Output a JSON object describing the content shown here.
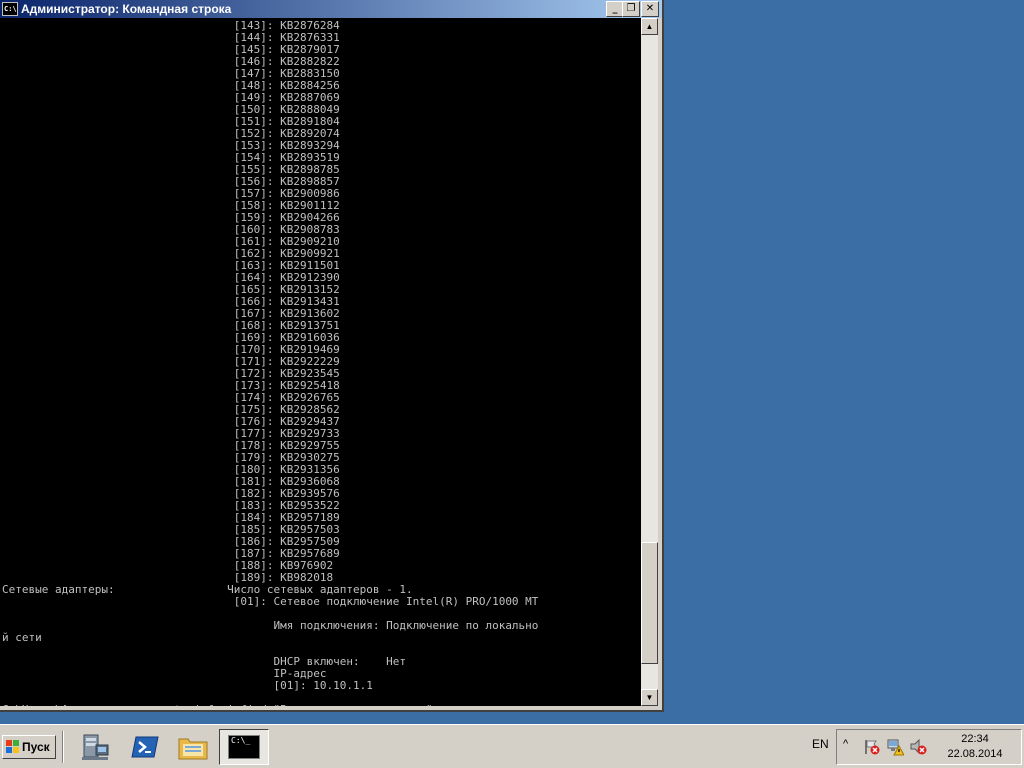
{
  "window": {
    "title": "Администратор: Командная строка",
    "icon_label": "C:\\",
    "icons": {
      "minimize": "minimize-icon",
      "maximize": "restore-icon",
      "close": "close-icon"
    },
    "minimize_glyph": "_",
    "maximize_glyph": "❐",
    "close_glyph": "✕"
  },
  "console": {
    "lines": [
      "                                   [143]: KB2876284",
      "                                   [144]: KB2876331",
      "                                   [145]: KB2879017",
      "                                   [146]: KB2882822",
      "                                   [147]: KB2883150",
      "                                   [148]: KB2884256",
      "                                   [149]: KB2887069",
      "                                   [150]: KB2888049",
      "                                   [151]: KB2891804",
      "                                   [152]: KB2892074",
      "                                   [153]: KB2893294",
      "                                   [154]: KB2893519",
      "                                   [155]: KB2898785",
      "                                   [156]: KB2898857",
      "                                   [157]: KB2900986",
      "                                   [158]: KB2901112",
      "                                   [159]: KB2904266",
      "                                   [160]: KB2908783",
      "                                   [161]: KB2909210",
      "                                   [162]: KB2909921",
      "                                   [163]: KB2911501",
      "                                   [164]: KB2912390",
      "                                   [165]: KB2913152",
      "                                   [166]: KB2913431",
      "                                   [167]: KB2913602",
      "                                   [168]: KB2913751",
      "                                   [169]: KB2916036",
      "                                   [170]: KB2919469",
      "                                   [171]: KB2922229",
      "                                   [172]: KB2923545",
      "                                   [173]: KB2925418",
      "                                   [174]: KB2926765",
      "                                   [175]: KB2928562",
      "                                   [176]: KB2929437",
      "                                   [177]: KB2929733",
      "                                   [178]: KB2929755",
      "                                   [179]: KB2930275",
      "                                   [180]: KB2931356",
      "                                   [181]: KB2936068",
      "                                   [182]: KB2939576",
      "                                   [183]: KB2953522",
      "                                   [184]: KB2957189",
      "                                   [185]: KB2957503",
      "                                   [186]: KB2957509",
      "                                   [187]: KB2957689",
      "                                   [188]: KB976902",
      "                                   [189]: KB982018",
      "Сетевые адаптеры:                 Число сетевых адаптеров - 1.",
      "                                   [01]: Сетевое подключение Intel(R) PRO/1000 MT",
      "",
      "                                         Имя подключения: Подключение по локально",
      "й сети",
      "",
      "                                         DHCP включен:    Нет",
      "                                         IP-адрес",
      "                                         [01]: 10.10.1.1",
      "",
      "C:\\Users\\Администратор>systeminfo | find \"Время загрузки системы\""
    ]
  },
  "scrollbar": {
    "up_glyph": "▲",
    "down_glyph": "▼"
  },
  "taskbar": {
    "start_label": "Пуск",
    "quick_launch": [
      "server-manager-icon",
      "powershell-icon",
      "explorer-folder-icon"
    ],
    "task_label": "C:\\_",
    "language": "EN",
    "tray_chevron": "^",
    "tray_icons": [
      "action-center-flag-icon",
      "network-warning-icon",
      "volume-muted-icon"
    ],
    "clock_time": "22:34",
    "clock_date": "22.08.2014"
  },
  "colors": {
    "desktop": "#3a6ea5",
    "titlebar_start": "#0a246a",
    "titlebar_end": "#a6caf0",
    "console_bg": "#000000",
    "console_fg": "#c0c0c0"
  }
}
